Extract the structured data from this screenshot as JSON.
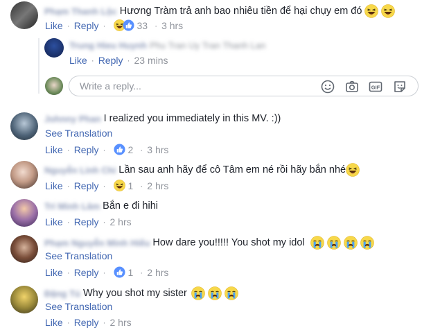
{
  "labels": {
    "like": "Like",
    "reply": "Reply",
    "see_translation": "See Translation",
    "reply_placeholder": "Write a reply..."
  },
  "comments": [
    {
      "name": "Phạm Thanh Lộc",
      "text": "Hương Tràm trả anh bao nhiêu tiền để hại chụy em đó",
      "reaction_count": "33",
      "time": "3 hrs"
    },
    {
      "name": "Trung Hieu Huynh",
      "text": "Phu Tran Uy Tran Thanh Lan",
      "time": "23 mins"
    },
    {
      "name": "Johnny Phan",
      "text": "I realized you immediately in this MV. :))",
      "reaction_count": "2",
      "time": "3 hrs"
    },
    {
      "name": "Nguyễn Linh Chi",
      "text": "Lần sau anh hãy để cô Tâm em né rồi hãy bắn nhé",
      "reaction_count": "1",
      "time": "2 hrs"
    },
    {
      "name": "Trí Minh Lâm",
      "text": "Bắn e đi hihi",
      "time": "2 hrs"
    },
    {
      "name": "Phạm Nguyễn Minh Hiếu",
      "text": "How dare you!!!!! You shot my idol",
      "reaction_count": "1",
      "time": "2 hrs"
    },
    {
      "name": "Đặng Tú",
      "text": "Why you shot my sister",
      "time": "2 hrs"
    }
  ],
  "colors": {
    "link": "#4267b2",
    "meta": "#90949c",
    "like_blue": "#5890ff",
    "haha_yellow": "#f7d84a"
  }
}
